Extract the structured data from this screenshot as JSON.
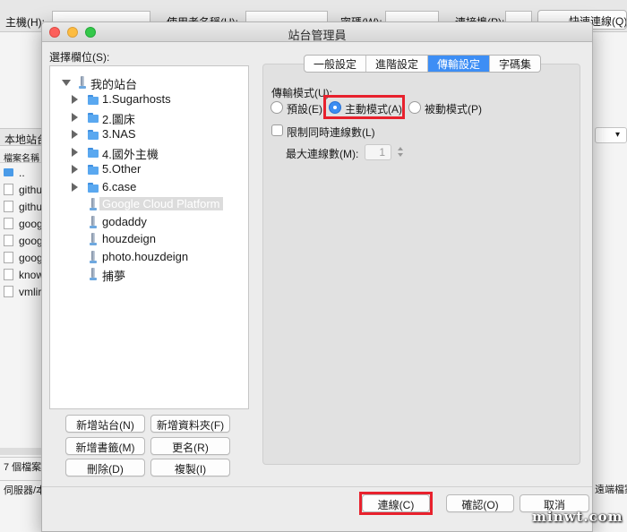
{
  "background": {
    "toolbar": {
      "host_label": "主機(H):",
      "username_label": "使用者名稱(U):",
      "password_label": "密碼(W):",
      "port_label": "連接埠(P):",
      "quickconnect_label": "快速連線(Q)"
    },
    "local_site_label": "本地站台",
    "file_column_label": "檔案名稱",
    "files": [
      "..",
      "githu",
      "githu",
      "goog",
      "goog",
      "goog",
      "know",
      "vmlir"
    ],
    "status_left": "7 個檔案.",
    "status_left2": "伺服器/本",
    "status_right": "遠端檔案"
  },
  "dialog": {
    "title": "站台管理員",
    "select_entry_label": "選擇欄位(S):",
    "tree": {
      "root": "我的站台",
      "items": [
        {
          "label": "1.Sugarhosts",
          "type": "folder"
        },
        {
          "label": "2.圖床",
          "type": "folder"
        },
        {
          "label": "3.NAS",
          "type": "folder"
        },
        {
          "label": "4.國外主機",
          "type": "folder"
        },
        {
          "label": "5.Other",
          "type": "folder"
        },
        {
          "label": "6.case",
          "type": "folder"
        },
        {
          "label": "Google Cloud Platform",
          "type": "site",
          "selected": true
        },
        {
          "label": "godaddy",
          "type": "site"
        },
        {
          "label": "houzdeign",
          "type": "site"
        },
        {
          "label": "photo.houzdeign",
          "type": "site"
        },
        {
          "label": "捕夢",
          "type": "site"
        }
      ]
    },
    "buttons": {
      "new_site": "新增站台(N)",
      "new_folder": "新增資料夾(F)",
      "new_bookmark": "新增書籤(M)",
      "rename": "更名(R)",
      "delete": "刪除(D)",
      "copy": "複製(I)"
    },
    "tabs": [
      "一般設定",
      "進階設定",
      "傳輸設定",
      "字碼集"
    ],
    "active_tab": "傳輸設定",
    "transfer": {
      "mode_label": "傳輸模式(U):",
      "modes": [
        "預設(E)",
        "主動模式(A)",
        "被動模式(P)"
      ],
      "selected_mode": "主動模式(A)",
      "limit_connections_label": "限制同時連線數(L)",
      "limit_connections_checked": false,
      "max_connections_label": "最大連線數(M):",
      "max_connections_value": "1"
    },
    "footer": {
      "connect": "連線(C)",
      "ok": "確認(O)",
      "cancel": "取消"
    },
    "highlight_color": "#e8212d",
    "accent_color": "#3d8ef5"
  },
  "watermark": "minwt.com"
}
